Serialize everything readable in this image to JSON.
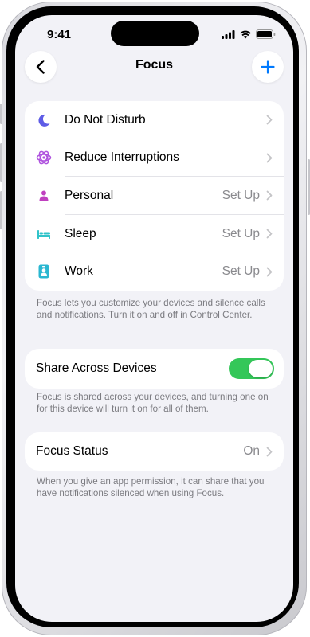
{
  "status_bar": {
    "time": "9:41"
  },
  "nav": {
    "title": "Focus"
  },
  "modes": [
    {
      "icon": "moon-icon",
      "label": "Do Not Disturb",
      "value": ""
    },
    {
      "icon": "reduce-interruptions-icon",
      "label": "Reduce Interruptions",
      "value": ""
    },
    {
      "icon": "person-icon",
      "label": "Personal",
      "value": "Set Up"
    },
    {
      "icon": "bed-icon",
      "label": "Sleep",
      "value": "Set Up"
    },
    {
      "icon": "work-badge-icon",
      "label": "Work",
      "value": "Set Up"
    }
  ],
  "modes_footnote": "Focus lets you customize your devices and silence calls and notifications. Turn it on and off in Control Center.",
  "share": {
    "label": "Share Across Devices",
    "enabled": true
  },
  "share_footnote": "Focus is shared across your devices, and turning one on for this device will turn it on for all of them.",
  "focus_status": {
    "label": "Focus Status",
    "value": "On"
  },
  "status_footnote": "When you give an app permission, it can share that you have notifications silenced when using Focus.",
  "colors": {
    "accent_blue": "#007aff",
    "dnd_purple": "#5e5ce6",
    "reduce_purple": "#af52de",
    "personal_purple": "#bf40bf",
    "sleep_teal": "#30c3c9",
    "work_teal": "#2ab7d1",
    "toggle_green": "#34c759"
  }
}
